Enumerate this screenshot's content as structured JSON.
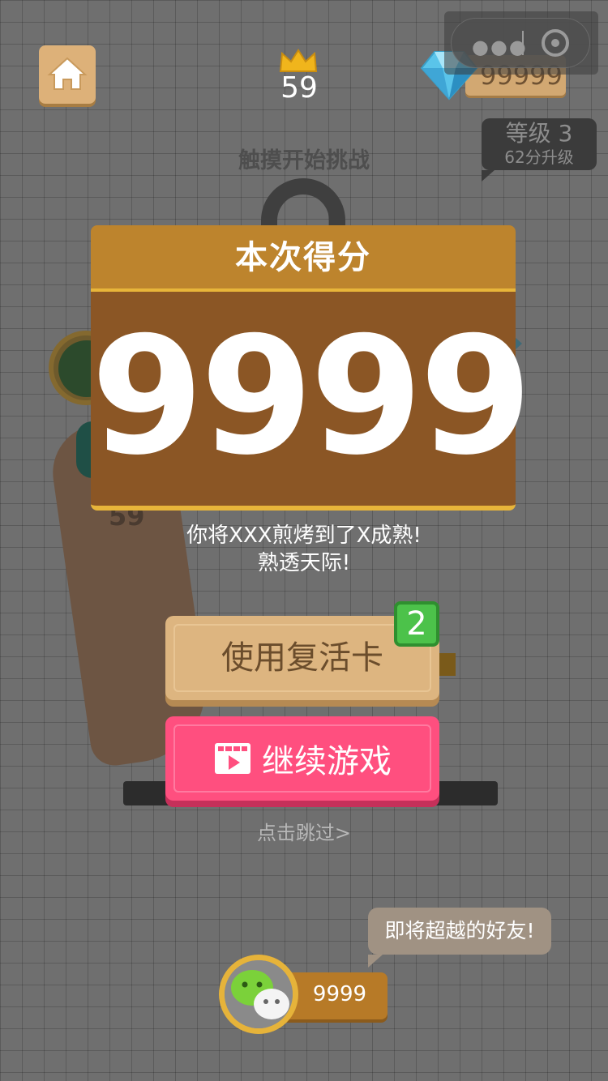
{
  "scene": {
    "hint": "触摸开始挑战",
    "pan_number": "59"
  },
  "header": {
    "home_icon": "home-icon",
    "crown_icon": "crown-icon",
    "best_score": "59",
    "gem_icon": "diamond-icon",
    "gem_count": "99999"
  },
  "level": {
    "title": "等级 3",
    "subtitle": "62分升级"
  },
  "result": {
    "title": "本次得分",
    "score": "9999",
    "message_line1": "你将XXX煎烤到了X成熟!",
    "message_line2": "熟透天际!"
  },
  "actions": {
    "revive_label": "使用复活卡",
    "revive_count": "2",
    "continue_label": "继续游戏",
    "continue_icon": "video-icon",
    "skip_label": "点击跳过>"
  },
  "friend": {
    "bubble": "即将超越的好友!",
    "score": "9999",
    "avatar_icon": "wechat-icon"
  },
  "colors": {
    "panel_header": "#bd842d",
    "panel_body": "#8b5625",
    "revive": "#ddb580",
    "continue": "#ff4f7f",
    "badge": "#4cc24a"
  }
}
